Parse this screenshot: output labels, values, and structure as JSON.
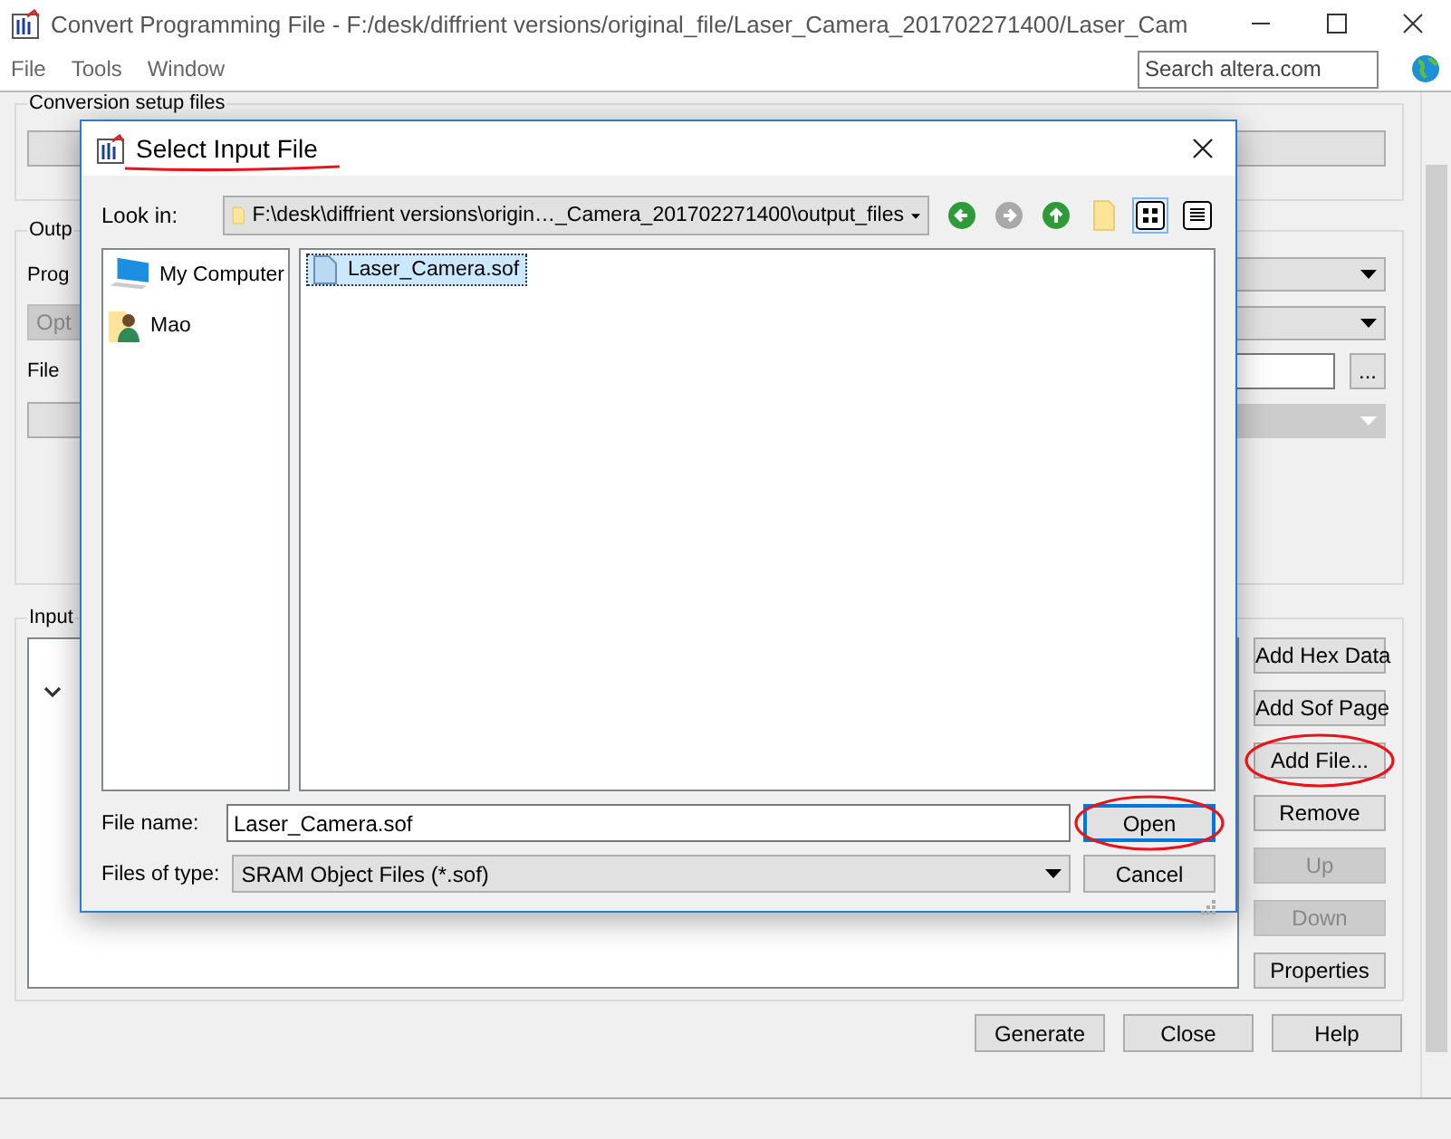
{
  "window": {
    "title": "Convert Programming File - F:/desk/diffrient versions/original_file/Laser_Camera_201702271400/Laser_Cam"
  },
  "menu": [
    {
      "label": "File"
    },
    {
      "label": "Tools"
    },
    {
      "label": "Window"
    }
  ],
  "search": {
    "placeholder": "Search altera.com"
  },
  "conversion_group": {
    "label": "Conversion setup files"
  },
  "output_group": {
    "label": "Outp",
    "programming_label": "Prog",
    "options_button": {
      "label": "Opt",
      "disabled": true
    },
    "file_name_label": "File",
    "browse_button": "...",
    "mode_dropdown": {
      "disabled": true
    }
  },
  "input_group": {
    "label": "Input",
    "buttons": [
      {
        "label": "Add Hex Data",
        "disabled": false
      },
      {
        "label": "Add Sof Page",
        "disabled": false
      },
      {
        "label": "Add File...",
        "disabled": false
      },
      {
        "label": "Remove",
        "disabled": false
      },
      {
        "label": "Up",
        "disabled": true
      },
      {
        "label": "Down",
        "disabled": true
      },
      {
        "label": "Properties",
        "disabled": false
      }
    ]
  },
  "footer_buttons": [
    {
      "label": "Generate"
    },
    {
      "label": "Close"
    },
    {
      "label": "Help"
    }
  ],
  "dialog": {
    "title": "Select Input File",
    "look_in": {
      "label": "Look in:",
      "value": "F:\\desk\\diffrient versions\\origin…_Camera_201702271400\\output_files"
    },
    "nav": [
      {
        "kind": "back",
        "disabled": false
      },
      {
        "kind": "forward",
        "disabled": true
      },
      {
        "kind": "up",
        "disabled": false
      },
      {
        "kind": "new-folder",
        "disabled": false
      }
    ],
    "view_modes": [
      {
        "kind": "icons",
        "selected": true
      },
      {
        "kind": "details",
        "selected": false
      }
    ],
    "places": [
      {
        "label": "My Computer",
        "kind": "computer"
      },
      {
        "label": "Mao",
        "kind": "user"
      }
    ],
    "files": [
      {
        "name": "Laser_Camera.sof",
        "selected": true
      }
    ],
    "file_name": {
      "label": "File name:",
      "value": "Laser_Camera.sof"
    },
    "file_type": {
      "label": "Files of type:",
      "value": "SRAM Object Files (*.sof)"
    },
    "buttons": [
      {
        "label": "Open",
        "default": true
      },
      {
        "label": "Cancel",
        "default": false
      }
    ]
  }
}
